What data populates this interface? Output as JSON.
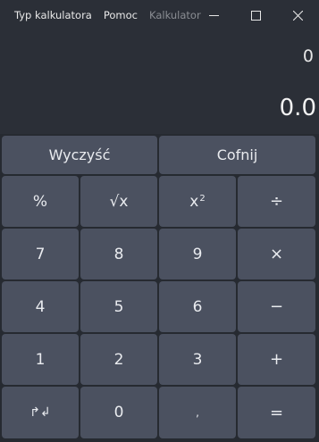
{
  "menu": {
    "item1": "Typ kalkulatora",
    "item2": "Pomoc",
    "app_title": "Kalkulator"
  },
  "display": {
    "expression": "0",
    "result": "0.0"
  },
  "buttons": {
    "clear": "Wyczyść",
    "backspace": "Cofnij",
    "percent": "%",
    "sqrt": "√x",
    "square_base": "x",
    "square_exp": "2",
    "divide": "÷",
    "seven": "7",
    "eight": "8",
    "nine": "9",
    "multiply": "×",
    "four": "4",
    "five": "5",
    "six": "6",
    "minus": "−",
    "one": "1",
    "two": "2",
    "three": "3",
    "plus": "+",
    "sign_toggle": "↱↲",
    "zero": "0",
    "decimal": ",",
    "equals": "="
  },
  "colors": {
    "button_bg": "#4b5160",
    "window_bg": "#2b2f37",
    "pad_bg": "#262a31",
    "text": "#e9ebef"
  }
}
